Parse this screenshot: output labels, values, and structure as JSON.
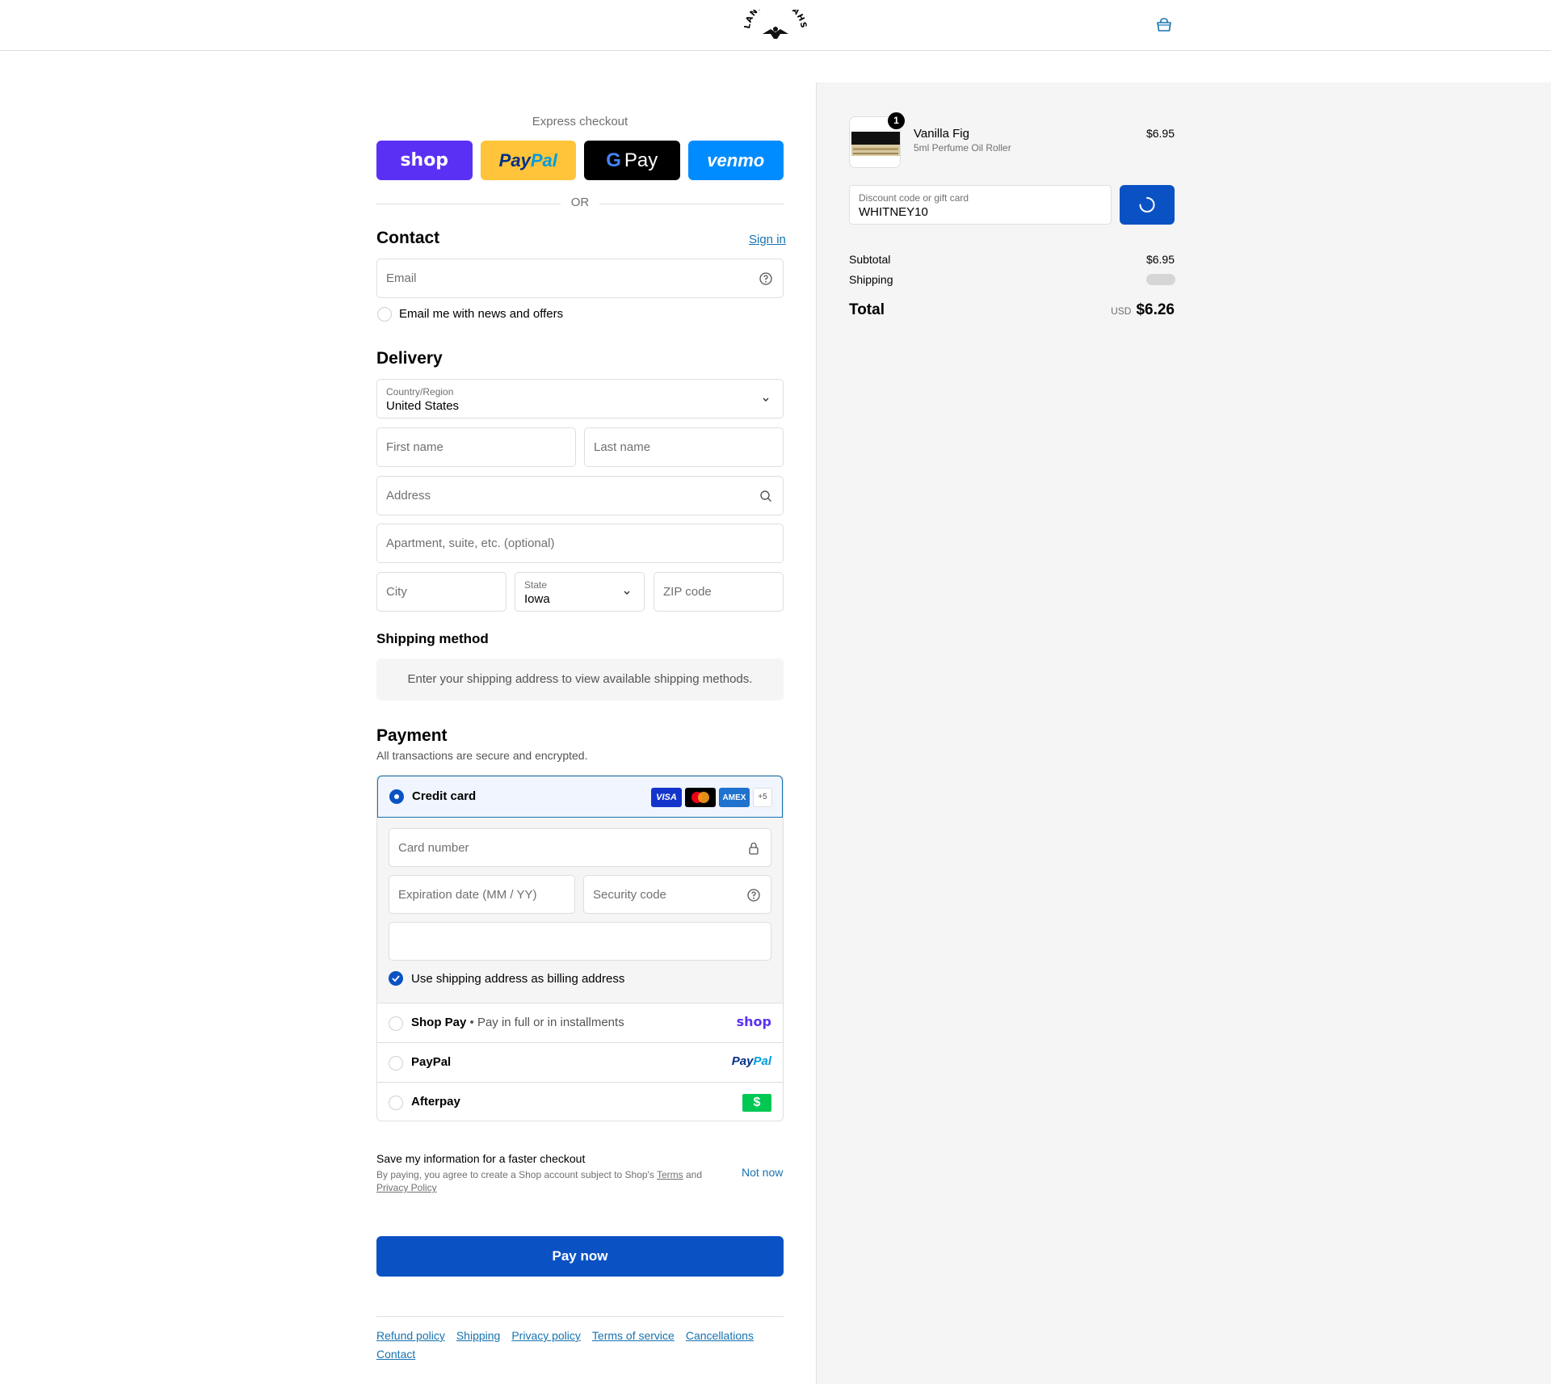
{
  "header": {
    "logo_text": "LAND OF AAHS",
    "cart_icon": "bag-icon"
  },
  "express": {
    "title": "Express checkout",
    "shop": "shop",
    "paypal_a": "Pay",
    "paypal_b": "Pal",
    "gpay_g": "G",
    "gpay": "Pay",
    "venmo": "venmo",
    "or": "OR"
  },
  "contact": {
    "heading": "Contact",
    "sign_in": "Sign in",
    "email_placeholder": "Email",
    "newsletter": "Email me with news and offers"
  },
  "delivery": {
    "heading": "Delivery",
    "country_label": "Country/Region",
    "country_value": "United States",
    "first_name": "First name",
    "last_name": "Last name",
    "address": "Address",
    "apartment": "Apartment, suite, etc. (optional)",
    "city": "City",
    "state_label": "State",
    "state_value": "Iowa",
    "zip": "ZIP code"
  },
  "shipping_method": {
    "heading": "Shipping method",
    "info": "Enter your shipping address to view available shipping methods."
  },
  "payment": {
    "heading": "Payment",
    "subtitle": "All transactions are secure and encrypted.",
    "credit_card": "Credit card",
    "card_brands": [
      "VISA",
      "MC",
      "AMEX"
    ],
    "more_brands": "+5",
    "card_number": "Card number",
    "expiration": "Expiration date (MM / YY)",
    "security_code": "Security code",
    "billing_same": "Use shipping address as billing address",
    "shop_pay": "Shop Pay",
    "shop_pay_sub": " • Pay in full or in installments",
    "shop_pay_logo": "shop",
    "paypal": "PayPal",
    "paypal_logo_a": "Pay",
    "paypal_logo_b": "Pal",
    "afterpay": "Afterpay",
    "afterpay_logo": "$"
  },
  "save_info": {
    "title": "Save my information for a faster checkout",
    "legal_a": "By paying, you agree to create a Shop account subject to Shop's ",
    "terms": "Terms",
    "legal_b": " and",
    "privacy": "Privacy Policy",
    "not_now": "Not now"
  },
  "pay_now": "Pay now",
  "footer": [
    "Refund policy",
    "Shipping",
    "Privacy policy",
    "Terms of service",
    "Cancellations",
    "Contact"
  ],
  "summary": {
    "item_name": "Vanilla Fig",
    "item_variant": "5ml Perfume Oil Roller",
    "item_price": "$6.95",
    "item_qty": "1",
    "discount_label": "Discount code or gift card",
    "discount_value": "WHITNEY10",
    "subtotal_label": "Subtotal",
    "subtotal_value": "$6.95",
    "shipping_label": "Shipping",
    "total_label": "Total",
    "currency": "USD",
    "total_value": "$6.26"
  },
  "colors": {
    "accent": "#0a52c4",
    "link": "#1773b0",
    "shop_purple": "#5a31f4",
    "paypal_yellow": "#ffc439",
    "venmo_blue": "#008cff",
    "afterpay_green": "#00c853"
  }
}
